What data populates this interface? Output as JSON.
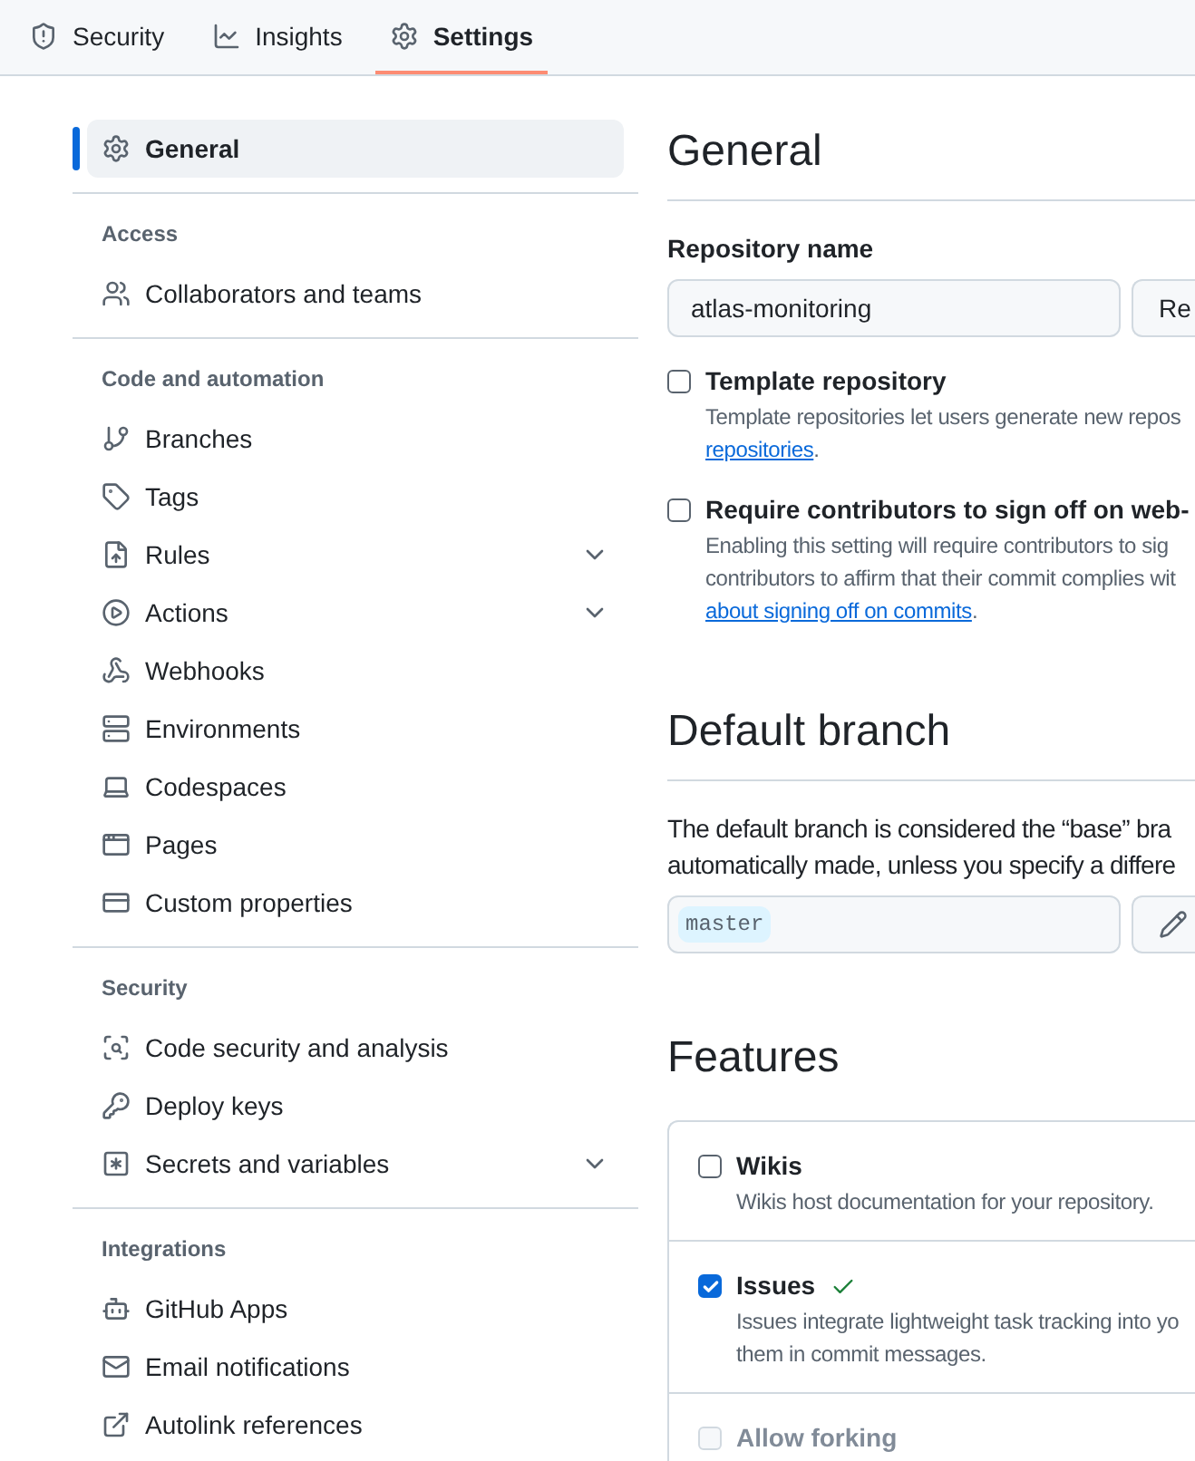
{
  "tabs": [
    {
      "label": "Security",
      "selected": false
    },
    {
      "label": "Insights",
      "selected": false
    },
    {
      "label": "Settings",
      "selected": true
    }
  ],
  "sidebar": {
    "sections": [
      {
        "items": [
          {
            "label": "General",
            "kind": "link",
            "selected": true
          }
        ]
      },
      {
        "title": "Access",
        "items": [
          {
            "label": "Collaborators and teams",
            "kind": "link",
            "selected": false
          }
        ]
      },
      {
        "title": "Code and automation",
        "items": [
          {
            "label": "Branches",
            "kind": "link",
            "selected": false
          },
          {
            "label": "Tags",
            "kind": "link",
            "selected": false
          },
          {
            "label": "Rules",
            "kind": "group",
            "expanded": false,
            "selected": false
          },
          {
            "label": "Actions",
            "kind": "group",
            "expanded": false,
            "selected": false
          },
          {
            "label": "Webhooks",
            "kind": "link",
            "selected": false
          },
          {
            "label": "Environments",
            "kind": "link",
            "selected": false
          },
          {
            "label": "Codespaces",
            "kind": "link",
            "selected": false
          },
          {
            "label": "Pages",
            "kind": "link",
            "selected": false
          },
          {
            "label": "Custom properties",
            "kind": "link",
            "selected": false
          }
        ]
      },
      {
        "title": "Security",
        "items": [
          {
            "label": "Code security and analysis",
            "kind": "link",
            "selected": false
          },
          {
            "label": "Deploy keys",
            "kind": "link",
            "selected": false
          },
          {
            "label": "Secrets and variables",
            "kind": "group",
            "expanded": false,
            "selected": false
          }
        ]
      },
      {
        "title": "Integrations",
        "items": [
          {
            "label": "GitHub Apps",
            "kind": "link",
            "selected": false
          },
          {
            "label": "Email notifications",
            "kind": "link",
            "selected": false
          },
          {
            "label": "Autolink references",
            "kind": "link",
            "selected": false
          }
        ]
      }
    ]
  },
  "general": {
    "title": "General",
    "repo_name": {
      "label": "Repository name",
      "value": "atlas-monitoring",
      "button": "Re"
    },
    "options": [
      {
        "title": "Template repository",
        "checked": false,
        "lines": [
          "Template repositories let users generate new repos"
        ],
        "link": "repositories",
        "after": "."
      },
      {
        "title": "Require contributors to sign off on web-",
        "checked": false,
        "lines": [
          "Enabling this setting will require contributors to sig",
          "contributors to affirm that their commit complies wit"
        ],
        "link": "about signing off on commits",
        "after": "."
      }
    ]
  },
  "default_branch": {
    "title": "Default branch",
    "lines": [
      "The default branch is considered the “base” bra",
      "automatically made, unless you specify a differe"
    ],
    "branch": "master"
  },
  "features": {
    "title": "Features",
    "items": [
      {
        "title": "Wikis",
        "checked": false,
        "disabled": false,
        "success": false,
        "lines": [
          "Wikis host documentation for your repository."
        ]
      },
      {
        "title": "Issues",
        "checked": true,
        "disabled": false,
        "success": true,
        "lines": [
          "Issues integrate lightweight task tracking into yo",
          "them in commit messages."
        ]
      },
      {
        "title": "Allow forking",
        "checked": false,
        "disabled": true,
        "success": false
      }
    ]
  }
}
